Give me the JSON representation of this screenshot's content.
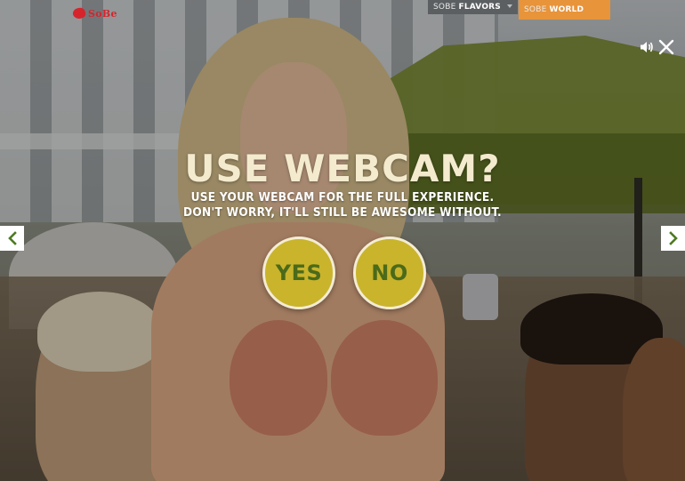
{
  "brand": {
    "logo_text": "SoBe",
    "logo_icon": "lizard-icon",
    "accent_red": "#d6242d"
  },
  "nav": {
    "flavors": {
      "prefix": "SOBE",
      "strong": "FLAVORS",
      "bg": "#5b5f61"
    },
    "world": {
      "prefix": "SOBE",
      "strong": "WORLD",
      "bg": "#e8943a"
    }
  },
  "controls": {
    "sound_icon": "speaker-icon",
    "close_icon": "close-icon",
    "prev_icon": "chevron-left-icon",
    "next_icon": "chevron-right-icon"
  },
  "modal": {
    "title": "USE WEBCAM?",
    "subtitle_line1": "USE YOUR WEBCAM FOR THE FULL EXPERIENCE.",
    "subtitle_line2": "DON'T WORRY, IT'LL STILL BE AWESOME WITHOUT.",
    "yes_label": "YES",
    "no_label": "NO",
    "button_color": "#c9b42c",
    "button_text_color": "#4b6a1a",
    "title_color": "#f4ebcf"
  }
}
